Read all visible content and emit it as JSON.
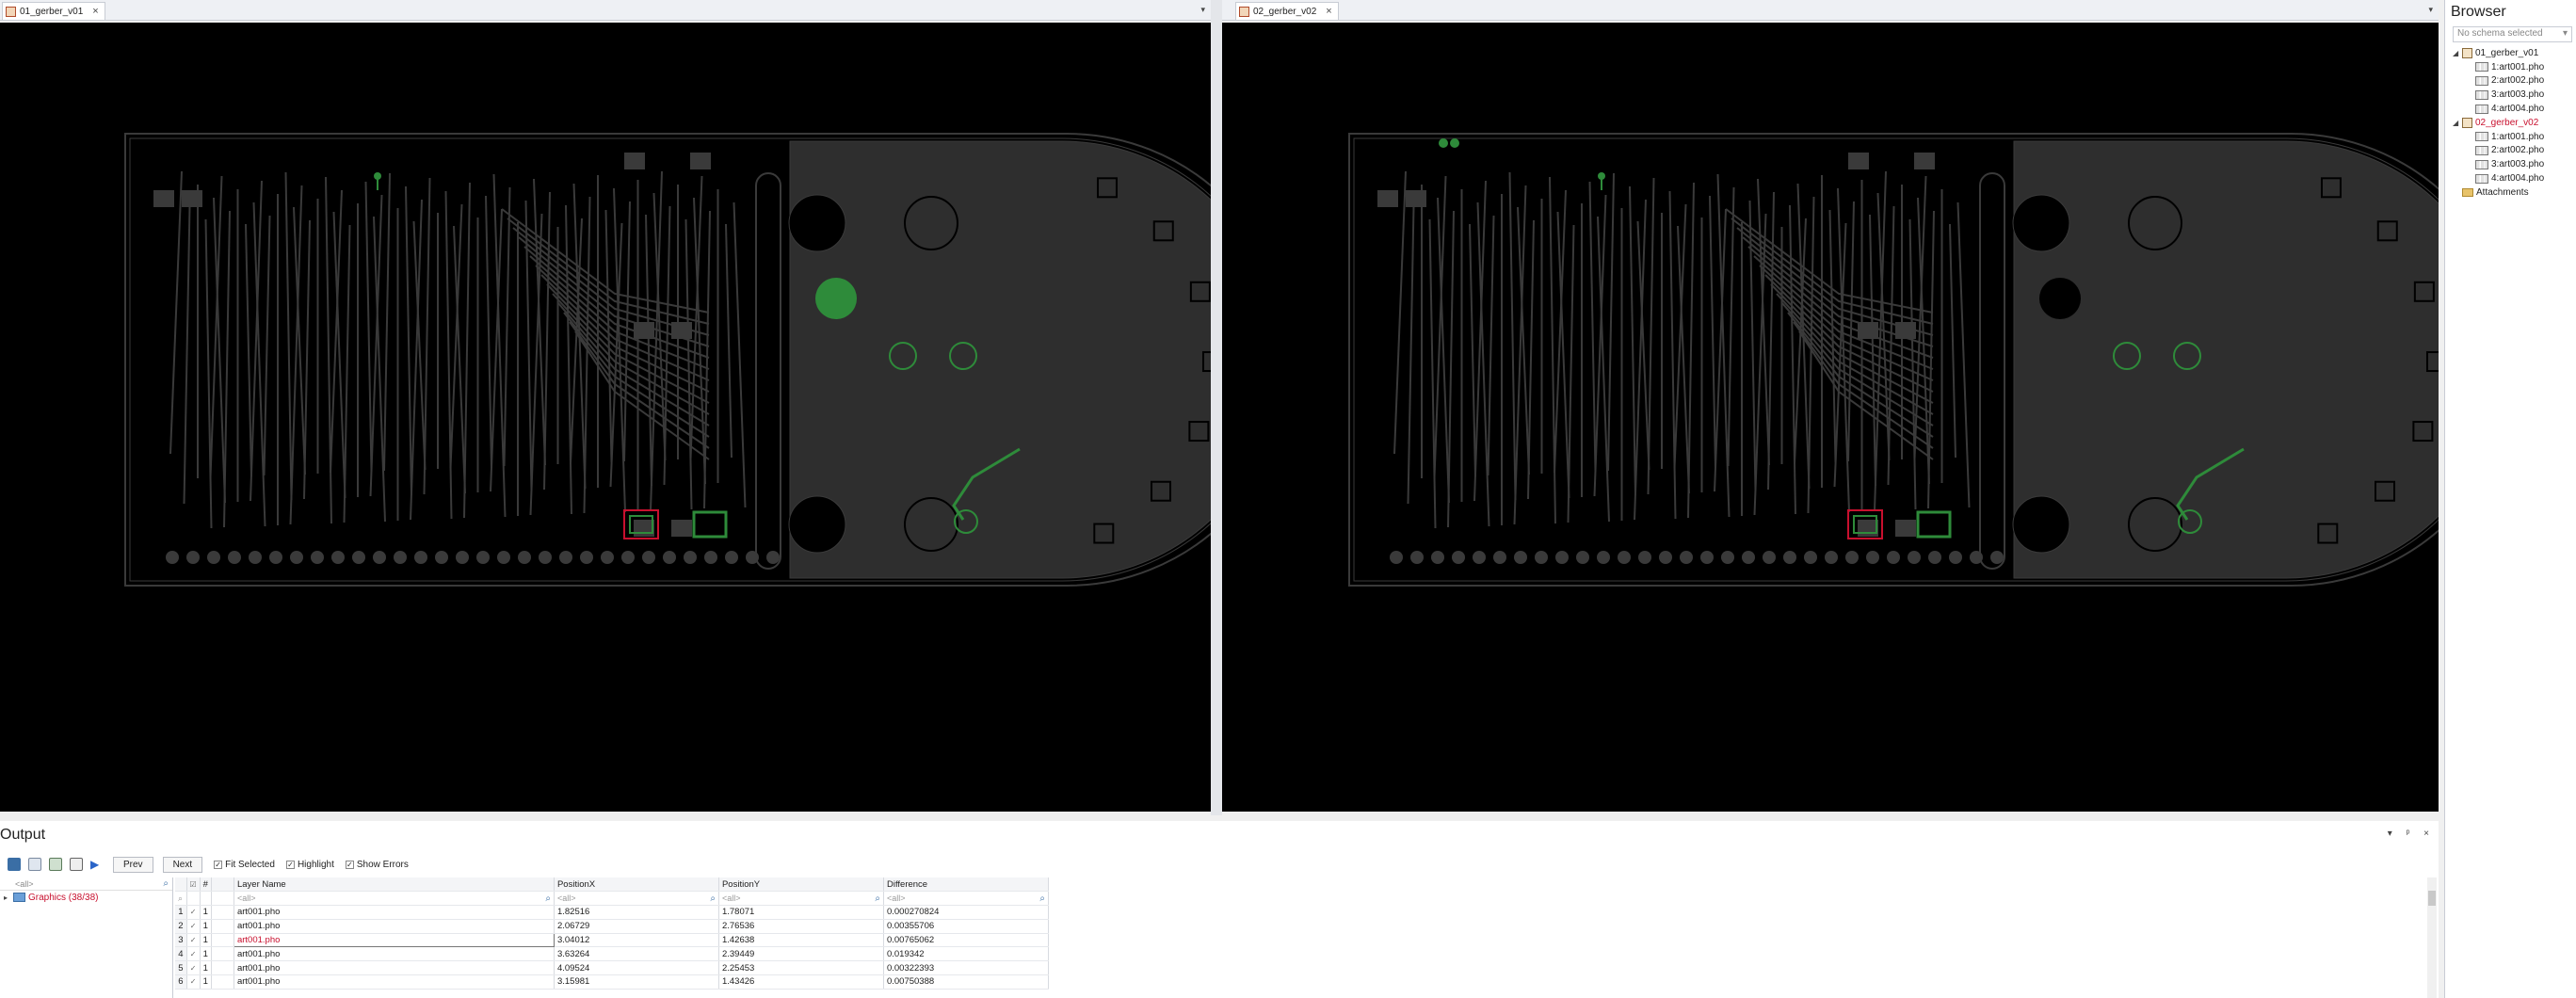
{
  "documents": [
    {
      "tab_label": "01_gerber_v01",
      "close_glyph": "×",
      "dropdown_glyph": "▾"
    },
    {
      "tab_label": "02_gerber_v02",
      "close_glyph": "×",
      "dropdown_glyph": "▾"
    }
  ],
  "browser": {
    "title": "Browser",
    "schema_placeholder": "No schema selected",
    "schema_dropdown_glyph": "▾",
    "tree": [
      {
        "label": "01_gerber_v01",
        "level": 0,
        "expanded": true,
        "color": "#222222"
      },
      {
        "label": "1:art001.pho",
        "level": 1
      },
      {
        "label": "2:art002.pho",
        "level": 1
      },
      {
        "label": "3:art003.pho",
        "level": 1
      },
      {
        "label": "4:art004.pho",
        "level": 1
      },
      {
        "label": "02_gerber_v02",
        "level": 0,
        "expanded": true,
        "color": "#c8102e"
      },
      {
        "label": "1:art001.pho",
        "level": 1
      },
      {
        "label": "2:art002.pho",
        "level": 1
      },
      {
        "label": "3:art003.pho",
        "level": 1
      },
      {
        "label": "4:art004.pho",
        "level": 1
      },
      {
        "label": "Attachments",
        "level": 0
      }
    ]
  },
  "output": {
    "title": "Output",
    "window_controls": "▾ ᵖ ×",
    "toolbar": {
      "prev_label": "Prev",
      "next_label": "Next",
      "fit_selected_label": "Fit Selected",
      "highlight_label": "Highlight",
      "show_errors_label": "Show Errors"
    },
    "left_tree": {
      "filter_placeholder": "<all>",
      "graphics_label": "Graphics (38/38)"
    },
    "grid": {
      "columns": [
        "#",
        "Layer Name",
        "PositionX",
        "PositionY",
        "Difference"
      ],
      "filter_placeholder": "<all>",
      "rows": [
        {
          "num": "1",
          "hash": "1",
          "layer": "art001.pho",
          "x": "1.82516",
          "y": "1.78071",
          "diff": "0.000270824"
        },
        {
          "num": "2",
          "hash": "1",
          "layer": "art001.pho",
          "x": "2.06729",
          "y": "2.76536",
          "diff": "0.00355706"
        },
        {
          "num": "3",
          "hash": "1",
          "layer": "art001.pho",
          "x": "3.04012",
          "y": "1.42638",
          "diff": "0.00765062"
        },
        {
          "num": "4",
          "hash": "1",
          "layer": "art001.pho",
          "x": "3.63264",
          "y": "2.39449",
          "diff": "0.019342"
        },
        {
          "num": "5",
          "hash": "1",
          "layer": "art001.pho",
          "x": "4.09524",
          "y": "2.25453",
          "diff": "0.00322393"
        },
        {
          "num": "6",
          "hash": "1",
          "layer": "art001.pho",
          "x": "3.15981",
          "y": "1.43426",
          "diff": "0.00750388"
        }
      ]
    }
  },
  "colors": {
    "canvas_bg": "#000000",
    "trace": "#3a3a3a",
    "fill": "#2e2e2e",
    "highlight_green": "#2e8b3a",
    "error_red": "#c8102e"
  }
}
